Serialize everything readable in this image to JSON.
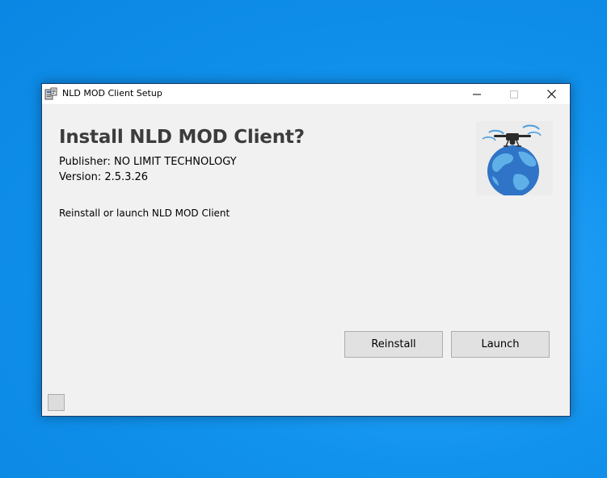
{
  "window": {
    "title": "NLD MOD Client Setup"
  },
  "content": {
    "heading": "Install NLD MOD Client?",
    "publisher": "Publisher: NO LIMIT TECHNOLOGY",
    "version": "Version: 2.5.3.26",
    "message": "Reinstall or launch NLD MOD Client"
  },
  "buttons": {
    "reinstall_label": "Reinstall",
    "launch_label": "Launch"
  },
  "icons": {
    "app": "installer-icon",
    "logo": "drone-globe-logo",
    "minimize": "minimize-icon",
    "maximize": "maximize-icon",
    "close": "close-icon"
  },
  "colors": {
    "desktop": "#0a86e3",
    "window_body": "#f1f1f1",
    "heading": "#3c3c3c",
    "globe_ocean": "#2f74c6"
  }
}
